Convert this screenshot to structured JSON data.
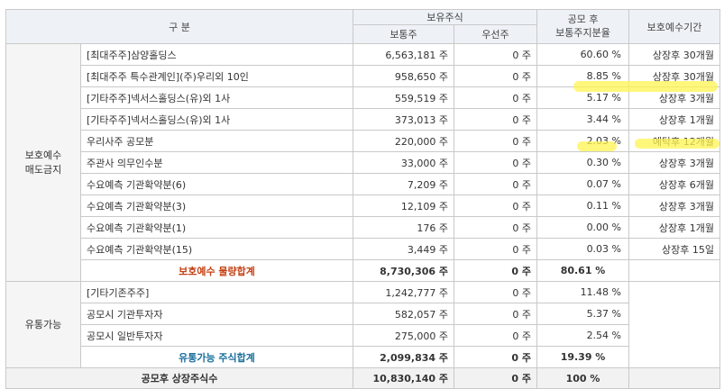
{
  "header": {
    "category": "구    분",
    "holdings": "보유주식",
    "ratio": "공모 후\n보통주지분율",
    "lockup": "보호예수기간",
    "common": "보통주",
    "preferred": "우선주"
  },
  "groups": {
    "locked": "보호예수\n매도금지",
    "tradable": "유통가능"
  },
  "locked_rows": [
    {
      "label": "[최대주주]삼양홀딩스",
      "common": "6,563,181 주",
      "pref": "0 주",
      "ratio": "60.60 %",
      "period": "상장후 30개월"
    },
    {
      "label": "[최대주주 특수관계인](주)우리외 10인",
      "common": "958,650 주",
      "pref": "0 주",
      "ratio": "8.85 %",
      "period": "상장후 30개월"
    },
    {
      "label": "[기타주주]넥서스홀딩스(유)외 1사",
      "common": "559,519 주",
      "pref": "0 주",
      "ratio": "5.17 %",
      "period": "상장후 3개월"
    },
    {
      "label": "[기타주주]넥서스홀딩스(유)외 1사",
      "common": "373,013 주",
      "pref": "0 주",
      "ratio": "3.44 %",
      "period": "상장후 1개월"
    },
    {
      "label": "우리사주 공모분",
      "common": "220,000 주",
      "pref": "0 주",
      "ratio": "2.03 %",
      "period": "예탁후 12개월"
    },
    {
      "label": "주관사 의무인수분",
      "common": "33,000 주",
      "pref": "0 주",
      "ratio": "0.30 %",
      "period": "상장후 3개월"
    },
    {
      "label": "수요예측 기관확약분(6)",
      "common": "7,209 주",
      "pref": "0 주",
      "ratio": "0.07 %",
      "period": "상장후 6개월"
    },
    {
      "label": "수요예측 기관확약분(3)",
      "common": "12,109 주",
      "pref": "0 주",
      "ratio": "0.11 %",
      "period": "상장후 3개월"
    },
    {
      "label": "수요예측 기관확약분(1)",
      "common": "176 주",
      "pref": "0 주",
      "ratio": "0.00 %",
      "period": "상장후 1개월"
    },
    {
      "label": "수요예측 기관확약분(15)",
      "common": "3,449 주",
      "pref": "0 주",
      "ratio": "0.03 %",
      "period": "상장후 15일"
    }
  ],
  "locked_total": {
    "label": "보호예수 물량합계",
    "common": "8,730,306 주",
    "pref": "0 주",
    "ratio": "80.61 %"
  },
  "tradable_rows": [
    {
      "label": "[기타기존주주]",
      "common": "1,242,777 주",
      "pref": "0 주",
      "ratio": "11.48 %"
    },
    {
      "label": "공모시 기관투자자",
      "common": "582,057 주",
      "pref": "0 주",
      "ratio": "5.37 %"
    },
    {
      "label": "공모시 일반투자자",
      "common": "275,000 주",
      "pref": "0 주",
      "ratio": "2.54 %"
    }
  ],
  "tradable_total": {
    "label": "유통가능 주식합계",
    "common": "2,099,834 주",
    "pref": "0 주",
    "ratio": "19.39 %"
  },
  "grand_total": {
    "label": "공모후 상장주식수",
    "common": "10,830,140 주",
    "pref": "0 주",
    "ratio": "100 %"
  },
  "colors": {
    "header_bg": "#eef2f7",
    "red_total": "#c43f12",
    "teal_total": "#1a6e9c",
    "highlight": "#fff450"
  }
}
